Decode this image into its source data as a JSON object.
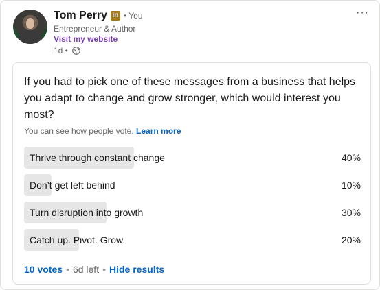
{
  "post": {
    "author": "Tom Perry",
    "badge": "in",
    "you_label": "• You",
    "subtitle": "Entrepreneur & Author",
    "website": "Visit my website",
    "time": "1d •",
    "more_menu": "···"
  },
  "poll": {
    "question": "If you had to pick one of these messages from a business that helps you adapt to change and grow stronger, which would interest you most?",
    "visibility_text": "You can see how people vote.",
    "learn_more": "Learn more",
    "options": [
      {
        "label": "Thrive through constant change",
        "percent_text": "40%",
        "percent": 40
      },
      {
        "label": "Don’t get left behind",
        "percent_text": "10%",
        "percent": 10
      },
      {
        "label": "Turn disruption into growth",
        "percent_text": "30%",
        "percent": 30
      },
      {
        "label": "Catch up. Pivot. Grow.",
        "percent_text": "20%",
        "percent": 20
      }
    ],
    "votes": "10 votes",
    "time_left": "6d left",
    "hide_results": "Hide results"
  },
  "colors": {
    "link": "#0a66c2",
    "website": "#7b3fb4",
    "bar": "#e6e6e6",
    "badge": "#a87a1f"
  },
  "icons": {
    "globe": "globe-icon",
    "more": "more-menu-icon"
  }
}
